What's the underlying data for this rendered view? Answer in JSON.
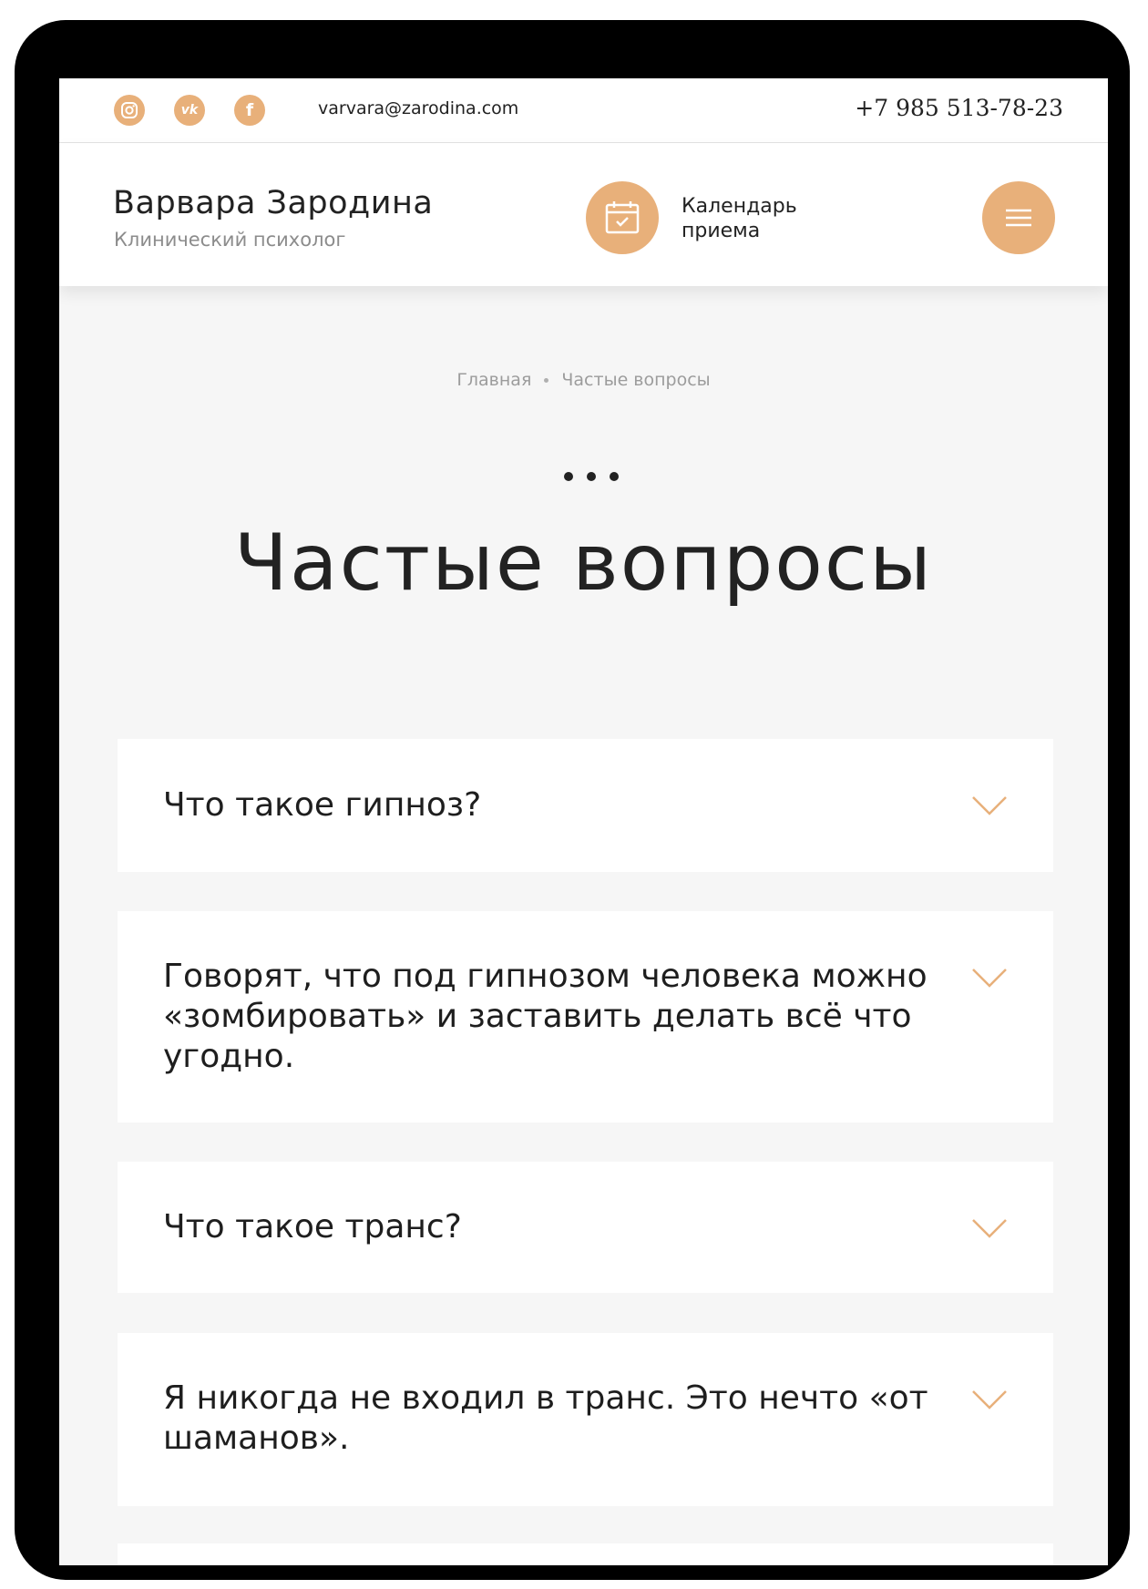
{
  "topbar": {
    "socials": [
      {
        "icon": "instagram-icon",
        "glyph": "◎"
      },
      {
        "icon": "vk-icon",
        "glyph": "vk"
      },
      {
        "icon": "facebook-icon",
        "glyph": "f"
      }
    ],
    "email": "varvara@zarodina.com",
    "phone": "+7 985 513-78-23"
  },
  "header": {
    "brand_name": "Варвара Зародина",
    "brand_sub": "Клинический психолог",
    "calendar_label_line1": "Календарь",
    "calendar_label_line2": "приема"
  },
  "breadcrumb": {
    "home": "Главная",
    "current": "Частые вопросы"
  },
  "page_title": "Частые вопросы",
  "faq": [
    {
      "question": "Что такое гипноз?"
    },
    {
      "question": "Говорят, что под гипнозом человека можно «зомбировать» и заставить делать всё что угодно."
    },
    {
      "question": "Что такое транс?"
    },
    {
      "question": "Я никогда не входил в транс. Это нечто «от шаманов»."
    }
  ],
  "colors": {
    "accent": "#e8b07a",
    "background": "#f6f6f6",
    "text": "#222222"
  }
}
